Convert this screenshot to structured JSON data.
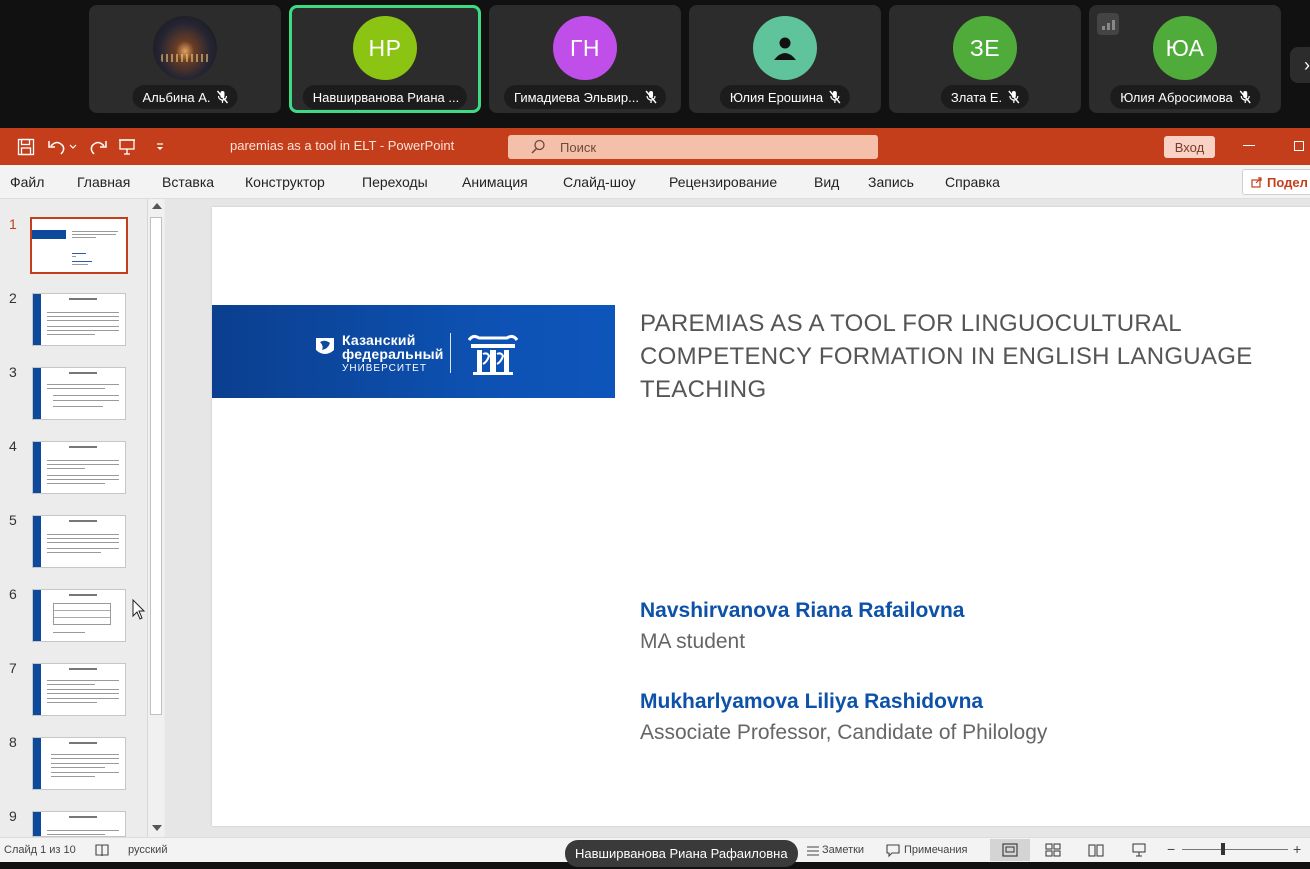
{
  "participants": [
    {
      "name": "Альбина А.",
      "initials": "",
      "color": "",
      "photo": true
    },
    {
      "name": "Навширванова Риана ...",
      "initials": "НР",
      "color": "#8cc413",
      "active": true
    },
    {
      "name": "Гимадиева Эльвир...",
      "initials": "ГН",
      "color": "#c04ee8"
    },
    {
      "name": "Юлия Ерошина",
      "initials": "",
      "color": "#5fc39b",
      "icon": "person-icon"
    },
    {
      "name": "Злата Е.",
      "initials": "ЗЕ",
      "color": "#4fac3a"
    },
    {
      "name": "Юлия Абросимова",
      "initials": "ЮА",
      "color": "#4fac3a"
    }
  ],
  "titlebar": {
    "doc_title": "paremias as a tool in ELT  -  PowerPoint",
    "search_placeholder": "Поиск",
    "login_label": "Вход"
  },
  "menu": [
    "Файл",
    "Главная",
    "Вставка",
    "Конструктор",
    "Переходы",
    "Анимация",
    "Слайд-шоу",
    "Рецензирование",
    "Вид",
    "Запись",
    "Справка"
  ],
  "share_label": "Подел",
  "thumbnails": [
    {
      "num": "1",
      "selected": true
    },
    {
      "num": "2"
    },
    {
      "num": "3"
    },
    {
      "num": "4"
    },
    {
      "num": "5"
    },
    {
      "num": "6"
    },
    {
      "num": "7"
    },
    {
      "num": "8"
    },
    {
      "num": "9"
    }
  ],
  "slide": {
    "logo_line1": "Казанский",
    "logo_line2": "федеральный",
    "logo_line3": "УНИВЕРСИТЕТ",
    "title": "PAREMIAS AS A TOOL FOR LINGUOCULTURAL COMPETENCY FORMATION IN ENGLISH LANGUAGE TEACHING",
    "author1": "Navshirvanova Riana Rafailovna",
    "role1": "MA student",
    "author2": "Mukharlyamova Liliya Rashidovna",
    "role2": "Associate Professor, Candidate of Philology"
  },
  "status": {
    "slide_counter": "Слайд 1 из 10",
    "language": "русский",
    "notes_label": "Заметки",
    "comments_label": "Примечания",
    "zoom_minus": "−",
    "zoom_plus": "+"
  },
  "speaker_label": "Навширванова Риана Рафаиловна",
  "colors": {
    "accent": "#c43e1c",
    "brand_blue": "#0d52a8",
    "active_border": "#3ddc84"
  }
}
